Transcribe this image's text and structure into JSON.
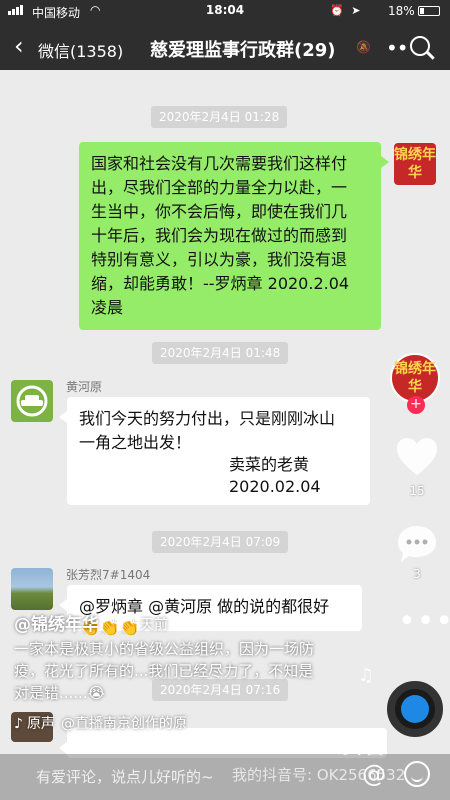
{
  "status_bar": {
    "carrier": "中国移动",
    "time": "18:04",
    "battery": "18%"
  },
  "header": {
    "back_label": "微信(1358)",
    "group_title": "慈爱理监事行政群(29)"
  },
  "messages": [
    {
      "type": "timestamp",
      "text": "2020年2月4日 01:28"
    },
    {
      "type": "outgoing",
      "avatar_text": "锦绣年华",
      "lines": [
        "国家和社会没有几次需要我们这样付",
        "出，尽我们全部的力量全力以赴，一",
        "生当中，你不会后悔，即使在我们几",
        "十年后，我们会为现在做过的而感到",
        "特别有意义，引以为豪，我们没有退",
        "缩，却能勇敢！--罗炳章 2020.2.04",
        "凌晨"
      ]
    },
    {
      "type": "timestamp",
      "text": "2020年2月4日 01:48"
    },
    {
      "type": "incoming",
      "sender": "黄河原",
      "lines": [
        "我们今天的努力付出，只是刚刚冰山",
        "一角之地出发！"
      ],
      "signature": [
        "卖菜的老黄",
        "2020.02.04"
      ]
    },
    {
      "type": "timestamp",
      "text": "2020年2月4日 07:09"
    },
    {
      "type": "incoming",
      "sender": "张芳烈7#1404",
      "lines": [
        "@罗炳章 @黄河原 做的说的都很好"
      ],
      "emoji": [
        "👏",
        "👏",
        "👏"
      ]
    },
    {
      "type": "timestamp",
      "text": "2020年2月4日 07:16"
    }
  ],
  "douyin": {
    "profile_text": "锦绣年华",
    "follow_plus": "+",
    "likes": "15",
    "comments": "3",
    "author": "@锦绣年华",
    "time_ago": "天前",
    "caption_lines": [
      "一家本是极其小的省级公益组织，因为一场防",
      "疫，花光了所有的...我们已经尽力了，不知是",
      "对是错......😭"
    ],
    "music_prefix": "原声",
    "music_tag": "@直播南京创作的原",
    "comment_placeholder": "有爱评论，说点儿好听的~",
    "watermark": "抖音",
    "douyin_id": "我的抖音号: OK2566532",
    "colors": {
      "like_red": "#fe2c55",
      "bubble_green": "#95ec69"
    }
  }
}
